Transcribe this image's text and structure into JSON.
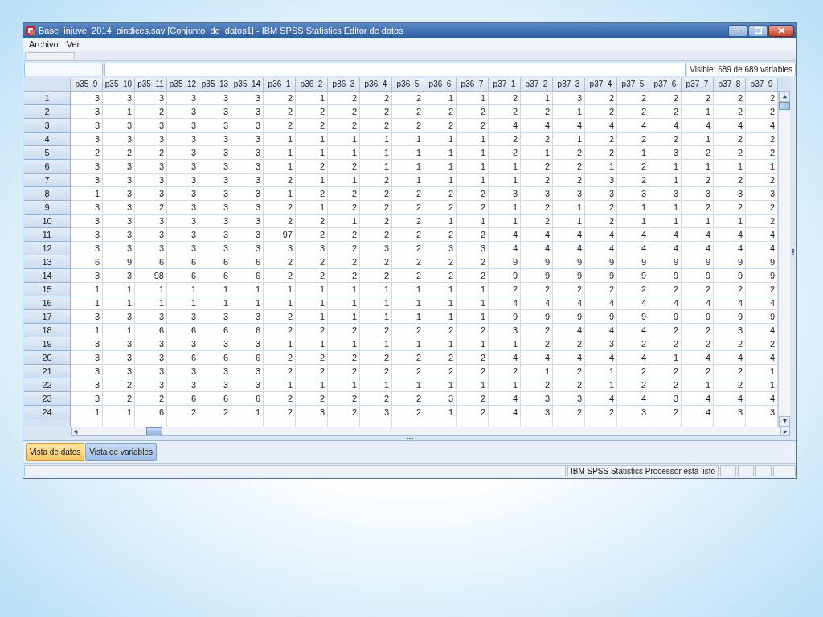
{
  "window": {
    "title": "Base_injuve_2014_pindices.sav [Conjunto_de_datos1] - IBM SPSS Statistics Editor de datos"
  },
  "menu": [
    "Archivo",
    "Ver"
  ],
  "cell_editor": {
    "visible_label": "Visible: 689 de 689 variables"
  },
  "grid": {
    "columns": [
      "p35_9",
      "p35_10",
      "p35_11",
      "p35_12",
      "p35_13",
      "p35_14",
      "p36_1",
      "p36_2",
      "p36_3",
      "p36_4",
      "p36_5",
      "p36_6",
      "p36_7",
      "p37_1",
      "p37_2",
      "p37_3",
      "p37_4",
      "p37_5",
      "p37_6",
      "p37_7",
      "p37_8",
      "p37_9"
    ],
    "rows": [
      {
        "number": "1",
        "cells": [
          "3",
          "3",
          "3",
          "3",
          "3",
          "3",
          "2",
          "1",
          "2",
          "2",
          "2",
          "1",
          "1",
          "2",
          "1",
          "3",
          "2",
          "2",
          "2",
          "2",
          "2",
          "2"
        ]
      },
      {
        "number": "2",
        "cells": [
          "3",
          "1",
          "2",
          "3",
          "3",
          "3",
          "2",
          "2",
          "2",
          "2",
          "2",
          "2",
          "2",
          "2",
          "2",
          "1",
          "2",
          "2",
          "2",
          "1",
          "2",
          "2"
        ]
      },
      {
        "number": "3",
        "cells": [
          "3",
          "3",
          "3",
          "3",
          "3",
          "3",
          "2",
          "2",
          "2",
          "2",
          "2",
          "2",
          "2",
          "4",
          "4",
          "4",
          "4",
          "4",
          "4",
          "4",
          "4",
          "4"
        ]
      },
      {
        "number": "4",
        "cells": [
          "3",
          "3",
          "3",
          "3",
          "3",
          "3",
          "1",
          "1",
          "1",
          "1",
          "1",
          "1",
          "1",
          "2",
          "2",
          "1",
          "2",
          "2",
          "2",
          "1",
          "2",
          "2"
        ]
      },
      {
        "number": "5",
        "cells": [
          "2",
          "2",
          "2",
          "3",
          "3",
          "3",
          "1",
          "1",
          "1",
          "1",
          "1",
          "1",
          "1",
          "2",
          "1",
          "2",
          "2",
          "1",
          "3",
          "2",
          "2",
          "2"
        ]
      },
      {
        "number": "6",
        "cells": [
          "3",
          "3",
          "3",
          "3",
          "3",
          "3",
          "1",
          "2",
          "2",
          "1",
          "1",
          "1",
          "1",
          "1",
          "2",
          "2",
          "1",
          "2",
          "1",
          "1",
          "1",
          "1"
        ]
      },
      {
        "number": "7",
        "cells": [
          "3",
          "3",
          "3",
          "3",
          "3",
          "3",
          "2",
          "1",
          "1",
          "2",
          "1",
          "1",
          "1",
          "1",
          "2",
          "2",
          "3",
          "2",
          "1",
          "2",
          "2",
          "2"
        ]
      },
      {
        "number": "8",
        "cells": [
          "1",
          "3",
          "3",
          "3",
          "3",
          "3",
          "1",
          "2",
          "2",
          "2",
          "2",
          "2",
          "2",
          "3",
          "3",
          "3",
          "3",
          "3",
          "3",
          "3",
          "3",
          "3"
        ]
      },
      {
        "number": "9",
        "cells": [
          "3",
          "3",
          "2",
          "3",
          "3",
          "3",
          "2",
          "1",
          "2",
          "2",
          "2",
          "2",
          "2",
          "1",
          "2",
          "1",
          "2",
          "1",
          "1",
          "2",
          "2",
          "2"
        ]
      },
      {
        "number": "10",
        "cells": [
          "3",
          "3",
          "3",
          "3",
          "3",
          "3",
          "2",
          "2",
          "1",
          "2",
          "2",
          "1",
          "1",
          "1",
          "2",
          "1",
          "2",
          "1",
          "1",
          "1",
          "1",
          "2"
        ]
      },
      {
        "number": "11",
        "cells": [
          "3",
          "3",
          "3",
          "3",
          "3",
          "3",
          "97",
          "2",
          "2",
          "2",
          "2",
          "2",
          "2",
          "4",
          "4",
          "4",
          "4",
          "4",
          "4",
          "4",
          "4",
          "4"
        ]
      },
      {
        "number": "12",
        "cells": [
          "3",
          "3",
          "3",
          "3",
          "3",
          "3",
          "3",
          "3",
          "2",
          "3",
          "2",
          "3",
          "3",
          "4",
          "4",
          "4",
          "4",
          "4",
          "4",
          "4",
          "4",
          "4"
        ]
      },
      {
        "number": "13",
        "cells": [
          "6",
          "9",
          "6",
          "6",
          "6",
          "6",
          "2",
          "2",
          "2",
          "2",
          "2",
          "2",
          "2",
          "9",
          "9",
          "9",
          "9",
          "9",
          "9",
          "9",
          "9",
          "9"
        ]
      },
      {
        "number": "14",
        "cells": [
          "3",
          "3",
          "98",
          "6",
          "6",
          "6",
          "2",
          "2",
          "2",
          "2",
          "2",
          "2",
          "2",
          "9",
          "9",
          "9",
          "9",
          "9",
          "9",
          "9",
          "9",
          "9"
        ]
      },
      {
        "number": "15",
        "cells": [
          "1",
          "1",
          "1",
          "1",
          "1",
          "1",
          "1",
          "1",
          "1",
          "1",
          "1",
          "1",
          "1",
          "2",
          "2",
          "2",
          "2",
          "2",
          "2",
          "2",
          "2",
          "2"
        ]
      },
      {
        "number": "16",
        "cells": [
          "1",
          "1",
          "1",
          "1",
          "1",
          "1",
          "1",
          "1",
          "1",
          "1",
          "1",
          "1",
          "1",
          "4",
          "4",
          "4",
          "4",
          "4",
          "4",
          "4",
          "4",
          "4"
        ]
      },
      {
        "number": "17",
        "cells": [
          "3",
          "3",
          "3",
          "3",
          "3",
          "3",
          "2",
          "1",
          "1",
          "1",
          "1",
          "1",
          "1",
          "9",
          "9",
          "9",
          "9",
          "9",
          "9",
          "9",
          "9",
          "9"
        ]
      },
      {
        "number": "18",
        "cells": [
          "1",
          "1",
          "6",
          "6",
          "6",
          "6",
          "2",
          "2",
          "2",
          "2",
          "2",
          "2",
          "2",
          "3",
          "2",
          "4",
          "4",
          "4",
          "2",
          "2",
          "3",
          "4"
        ]
      },
      {
        "number": "19",
        "cells": [
          "3",
          "3",
          "3",
          "3",
          "3",
          "3",
          "1",
          "1",
          "1",
          "1",
          "1",
          "1",
          "1",
          "1",
          "2",
          "2",
          "3",
          "2",
          "2",
          "2",
          "2",
          "2"
        ]
      },
      {
        "number": "20",
        "cells": [
          "3",
          "3",
          "3",
          "6",
          "6",
          "6",
          "2",
          "2",
          "2",
          "2",
          "2",
          "2",
          "2",
          "4",
          "4",
          "4",
          "4",
          "4",
          "1",
          "4",
          "4",
          "4"
        ]
      },
      {
        "number": "21",
        "cells": [
          "3",
          "3",
          "3",
          "3",
          "3",
          "3",
          "2",
          "2",
          "2",
          "2",
          "2",
          "2",
          "2",
          "2",
          "1",
          "2",
          "1",
          "2",
          "2",
          "2",
          "2",
          "1"
        ]
      },
      {
        "number": "22",
        "cells": [
          "3",
          "2",
          "3",
          "3",
          "3",
          "3",
          "1",
          "1",
          "1",
          "1",
          "1",
          "1",
          "1",
          "1",
          "2",
          "2",
          "1",
          "2",
          "2",
          "1",
          "2",
          "1"
        ]
      },
      {
        "number": "23",
        "cells": [
          "3",
          "2",
          "2",
          "6",
          "6",
          "6",
          "2",
          "2",
          "2",
          "2",
          "2",
          "3",
          "2",
          "4",
          "3",
          "3",
          "4",
          "4",
          "3",
          "4",
          "4",
          "4"
        ]
      },
      {
        "number": "24",
        "cells": [
          "1",
          "1",
          "6",
          "2",
          "2",
          "1",
          "2",
          "3",
          "2",
          "3",
          "2",
          "1",
          "2",
          "4",
          "3",
          "2",
          "2",
          "3",
          "2",
          "4",
          "3",
          "3"
        ]
      }
    ]
  },
  "view_tabs": [
    {
      "label": "Vista de datos",
      "selected": true
    },
    {
      "label": "Vista de variables",
      "selected": false
    }
  ],
  "status_bar": {
    "message": "IBM SPSS Statistics Processor está listo"
  }
}
